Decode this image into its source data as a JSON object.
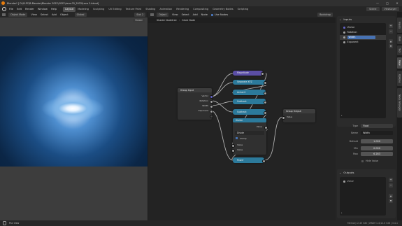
{
  "title_bar": {
    "title": "Blender* [ D:\\B.PC\\B.Blender\\Blender 2022\\2022\\Lens 03_2022\\Lens 2.blend]",
    "controls": [
      "—",
      "□",
      "✕"
    ]
  },
  "menu": {
    "items": [
      "File",
      "Edit",
      "Render",
      "Window",
      "Help"
    ],
    "workspace_tabs": [
      "Layout",
      "Modeling",
      "Sculpting",
      "UV Editing",
      "Texture Paint",
      "Shading",
      "Animation",
      "Rendering",
      "Compositing",
      "Geometry Nodes",
      "Scripting"
    ],
    "active_tab": "Layout",
    "scene": "Scene",
    "view_layer": "ViewLayer"
  },
  "viewport": {
    "mode": "Object Mode",
    "menus": [
      "View",
      "Select",
      "Add",
      "Object"
    ],
    "shading_label": "Global",
    "slot_label": "Slot 2",
    "view_label": "Viewer"
  },
  "node_editor": {
    "mode": "Object",
    "menus": [
      "View",
      "Select",
      "Add",
      "Node"
    ],
    "backdrop": "Backdrop",
    "breadcrumb": [
      "Shader Nodetree",
      "Glare Node"
    ],
    "use_nodes_label": "Use Nodes",
    "group_input": {
      "title": "Group Input",
      "outputs": [
        "Vector",
        "Rotation",
        "Width",
        "Exponent"
      ]
    },
    "group_output": {
      "title": "Group Output",
      "inputs": [
        "Value"
      ]
    },
    "math_nodes": [
      {
        "title": "Magnitude",
        "color": "#5b4ea6"
      },
      {
        "title": "Separate XYZ",
        "color": "#2c7a9b"
      },
      {
        "title": "Arctan2",
        "color": "#2c7a9b"
      },
      {
        "title": "Subtract",
        "color": "#2c7a9b"
      },
      {
        "title": "Subtract",
        "color": "#2c7a9b"
      }
    ],
    "divide_node": {
      "title": "Divide",
      "operation": "Divide",
      "clamp_label": "Clamp",
      "value_labels": [
        "Value",
        "Value"
      ]
    },
    "power_node": {
      "title": "Power",
      "color": "#2c7a9b"
    }
  },
  "sidebar": {
    "inputs_header": "Inputs",
    "inputs": [
      {
        "name": "Vector",
        "selected": false
      },
      {
        "name": "Rotation",
        "selected": false
      },
      {
        "name": "Width",
        "selected": true
      },
      {
        "name": "Exponent",
        "selected": false
      }
    ],
    "type_label": "Type",
    "type_value": "Float",
    "name_label": "Name",
    "name_value": "Width",
    "default_label": "Default",
    "default_value": "1.000",
    "min_label": "Min",
    "min_value": "0.000",
    "max_label": "Max",
    "max_value": "6.283",
    "hide_value_label": "Hide Value",
    "outputs_header": "Outputs",
    "outputs": [
      {
        "name": "Value"
      }
    ]
  },
  "right_tabs": [
    "Inputs",
    "Item",
    "Tool",
    "View",
    "Options",
    "Node Wrangler"
  ],
  "right_tabs_active": "View",
  "status_bar": {
    "left": "Pan View",
    "right": "Memory 2.45 GiB | VRAM 1.4/12.0 GiB | 3.4.1"
  }
}
